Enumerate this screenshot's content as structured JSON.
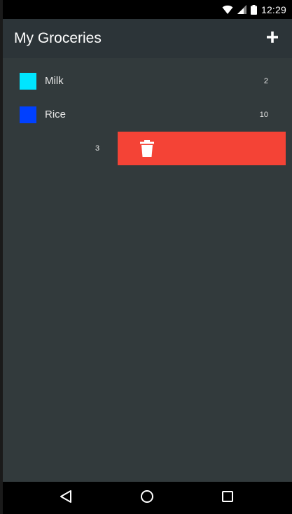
{
  "status_bar": {
    "time": "12:29"
  },
  "app_bar": {
    "title": "My Groceries",
    "add_icon": "plus-icon"
  },
  "items": [
    {
      "name": "Milk",
      "quantity": "2",
      "color": "#00e5ff"
    },
    {
      "name": "Rice",
      "quantity": "10",
      "color": "#0040ff"
    },
    {
      "name": "",
      "quantity": "3",
      "color": "",
      "swiped": true,
      "action_color": "#f44336",
      "action_icon": "trash-icon"
    }
  ],
  "nav_bar": {
    "icons": [
      "back-icon",
      "home-icon",
      "recents-icon"
    ]
  },
  "colors": {
    "background": "#323a3c",
    "app_bar": "#2c3438",
    "delete": "#f44336"
  }
}
